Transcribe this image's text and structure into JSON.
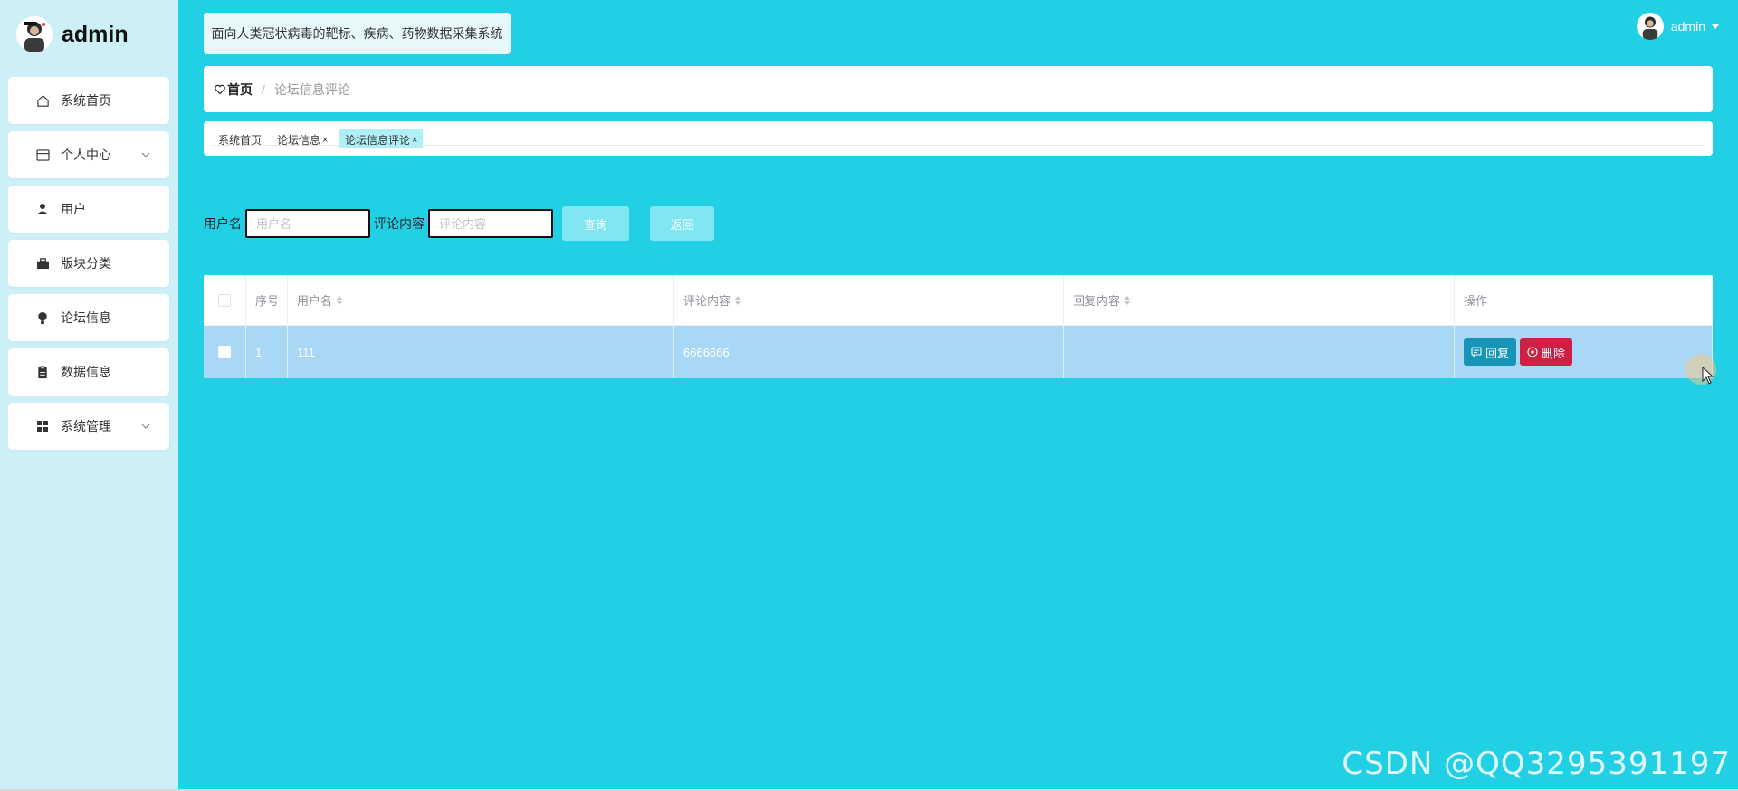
{
  "sidebar": {
    "brand_name": "admin",
    "items": [
      {
        "label": "系统首页",
        "icon": "home-icon"
      },
      {
        "label": "个人中心",
        "icon": "id-card-icon",
        "has_submenu": true
      },
      {
        "label": "用户",
        "icon": "user-icon"
      },
      {
        "label": "版块分类",
        "icon": "briefcase-icon"
      },
      {
        "label": "论坛信息",
        "icon": "bulb-icon"
      },
      {
        "label": "数据信息",
        "icon": "clipboard-icon"
      },
      {
        "label": "系统管理",
        "icon": "grid-icon",
        "has_submenu": true
      }
    ]
  },
  "header": {
    "system_title": "面向人类冠状病毒的靶标、疾病、药物数据采集系统",
    "user_name": "admin"
  },
  "breadcrumb": {
    "home": "首页",
    "separator": "/",
    "current": "论坛信息评论"
  },
  "tabs": [
    {
      "label": "系统首页",
      "closable": false,
      "active": false
    },
    {
      "label": "论坛信息",
      "closable": true,
      "active": false
    },
    {
      "label": "论坛信息评论",
      "closable": true,
      "active": true
    }
  ],
  "search": {
    "username_label": "用户名",
    "username_placeholder": "用户名",
    "comment_label": "评论内容",
    "comment_placeholder": "评论内容",
    "query_button": "查询",
    "back_button": "返回"
  },
  "table": {
    "columns": {
      "index": "序号",
      "username": "用户名",
      "comment": "评论内容",
      "reply": "回复内容",
      "operation": "操作"
    },
    "rows": [
      {
        "index": "1",
        "username": "111",
        "comment": "6666666",
        "reply": ""
      }
    ],
    "reply_button": "回复",
    "delete_button": "删除"
  },
  "watermark": "CSDN @QQ3295391197",
  "colors": {
    "main_bg": "#22d0e6",
    "sidebar_bg": "#cdf0f6",
    "selected_row": "#a8d8f6",
    "reply_button": "#1795b8",
    "delete_button": "#cf1f45"
  }
}
